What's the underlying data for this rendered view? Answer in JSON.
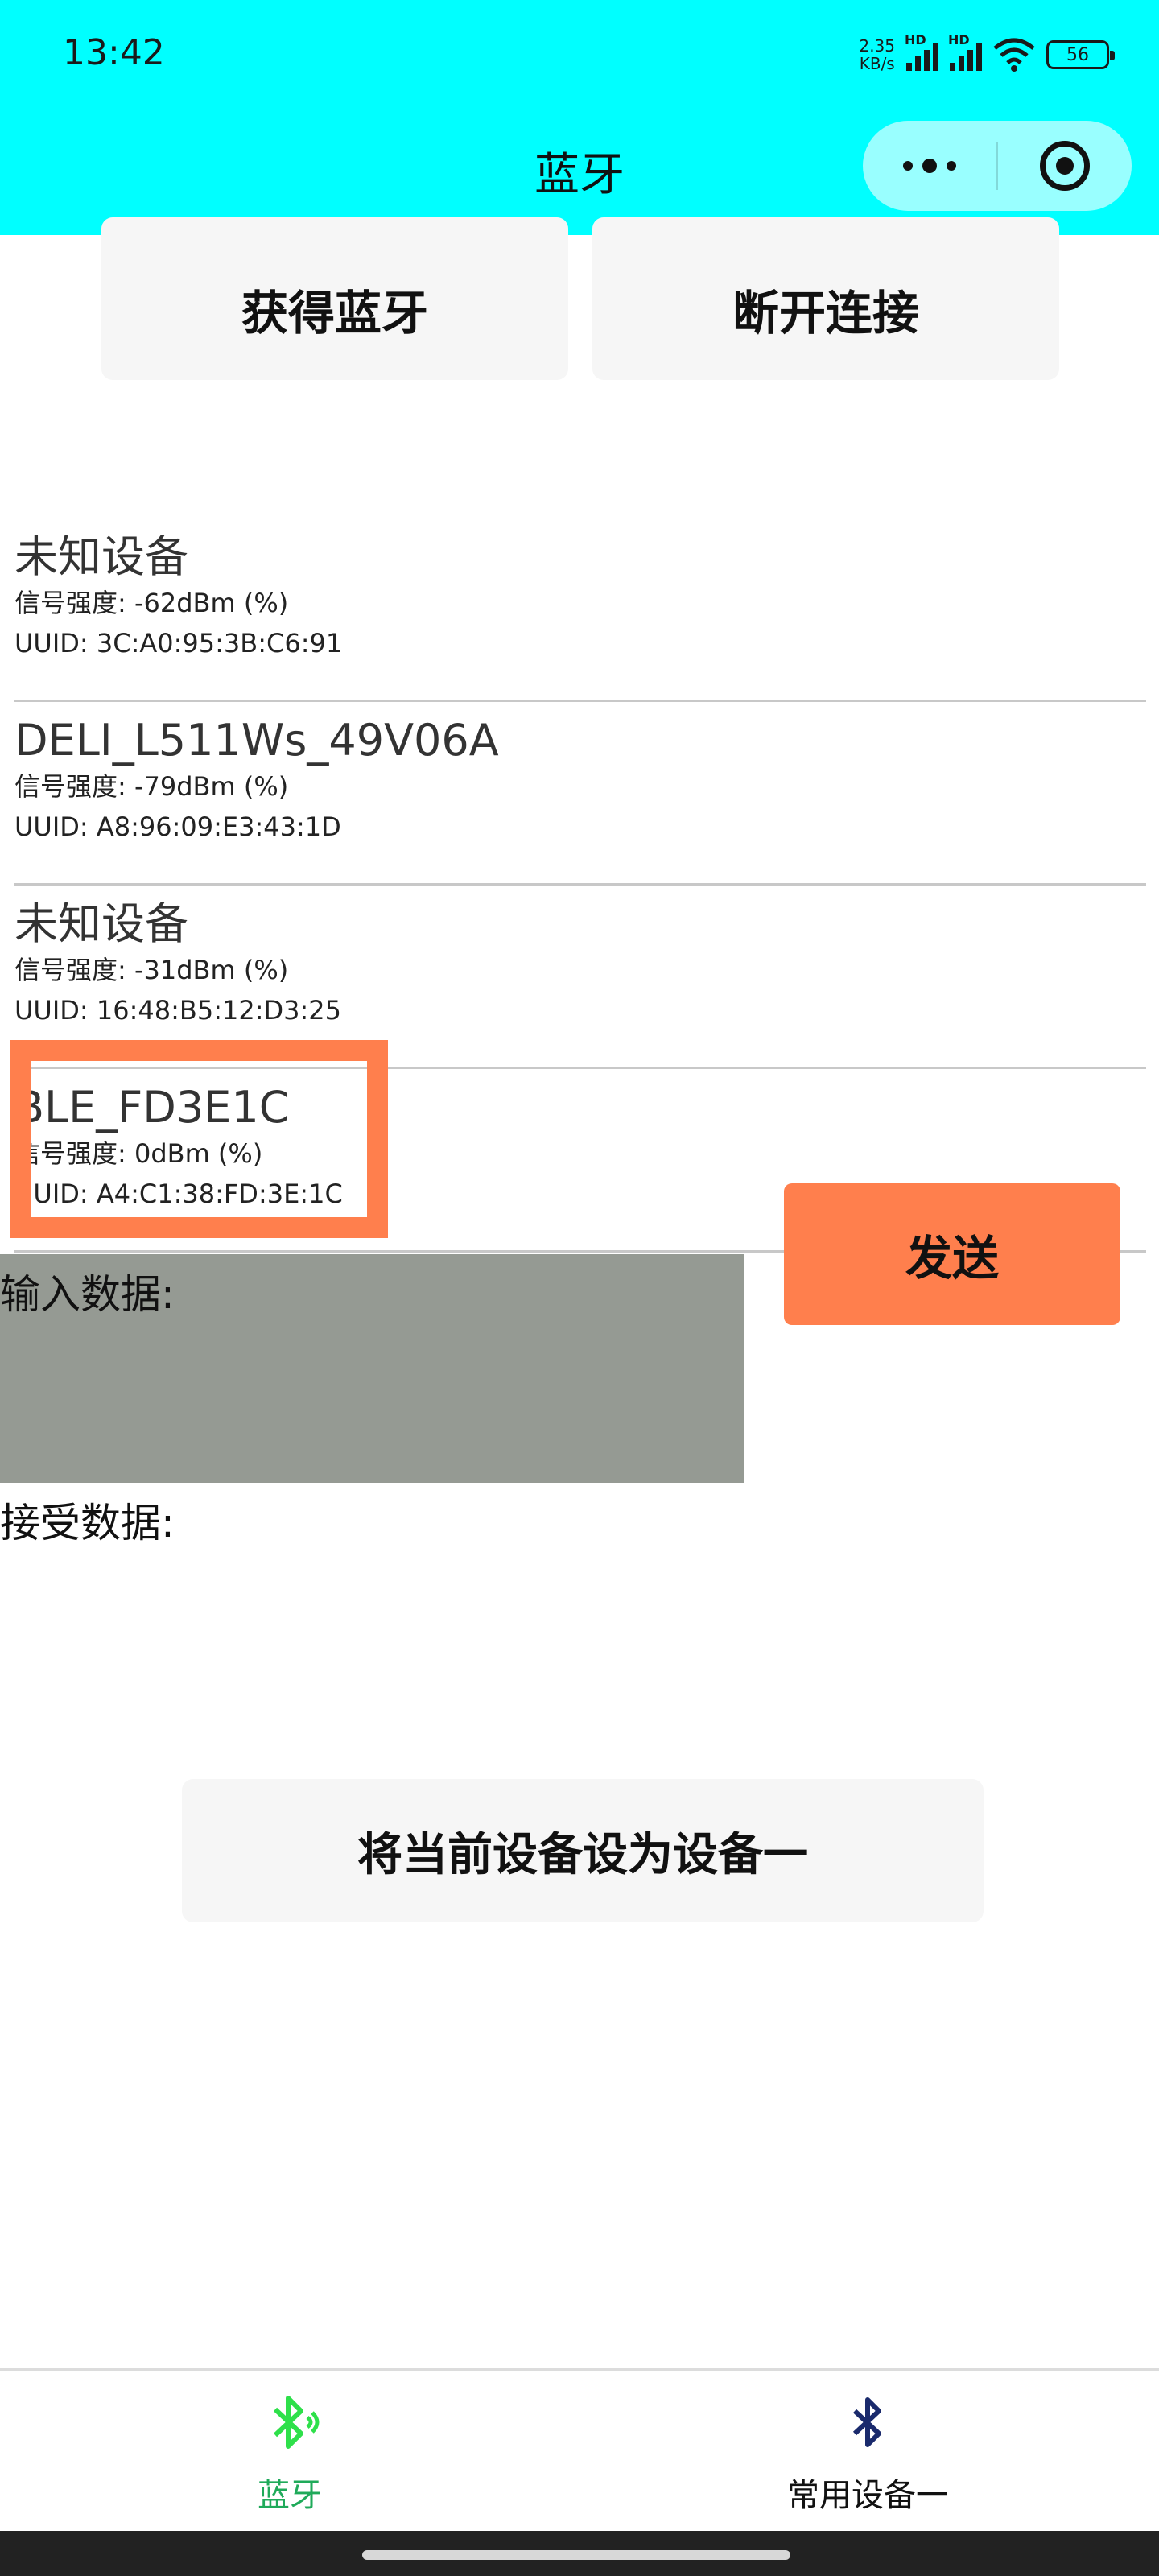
{
  "status_bar": {
    "time": "13:42",
    "speed_value": "2.35",
    "speed_unit": "KB/s",
    "hd1": "HD",
    "hd2": "HD",
    "battery": "56"
  },
  "nav": {
    "title": "蓝牙"
  },
  "buttons": {
    "get_bluetooth": "获得蓝牙",
    "disconnect": "断开连接",
    "send": "发送",
    "set_as_device_one": "将当前设备设为设备一"
  },
  "devices": [
    {
      "name": "未知设备",
      "signal": "信号强度: -62dBm (%)",
      "uuid": "UUID: 3C:A0:95:3B:C6:91"
    },
    {
      "name": "DELI_L511Ws_49V06A",
      "signal": "信号强度: -79dBm (%)",
      "uuid": "UUID: A8:96:09:E3:43:1D"
    },
    {
      "name": "未知设备",
      "signal": "信号强度: -31dBm (%)",
      "uuid": "UUID: 16:48:B5:12:D3:25"
    },
    {
      "name": "BLE_FD3E1C",
      "signal": "信号强度: 0dBm (%)",
      "uuid": "UUID: A4:C1:38:FD:3E:1C"
    }
  ],
  "labels": {
    "input_data": "输入数据:",
    "received_data": "接受数据:"
  },
  "tabbar": {
    "tab1": "蓝牙",
    "tab2": "常用设备一"
  },
  "colors": {
    "header_bg": "#00ffff",
    "accent_orange": "#ff7f4d",
    "tab_active": "#1faa5a",
    "input_bg": "#959a93"
  }
}
